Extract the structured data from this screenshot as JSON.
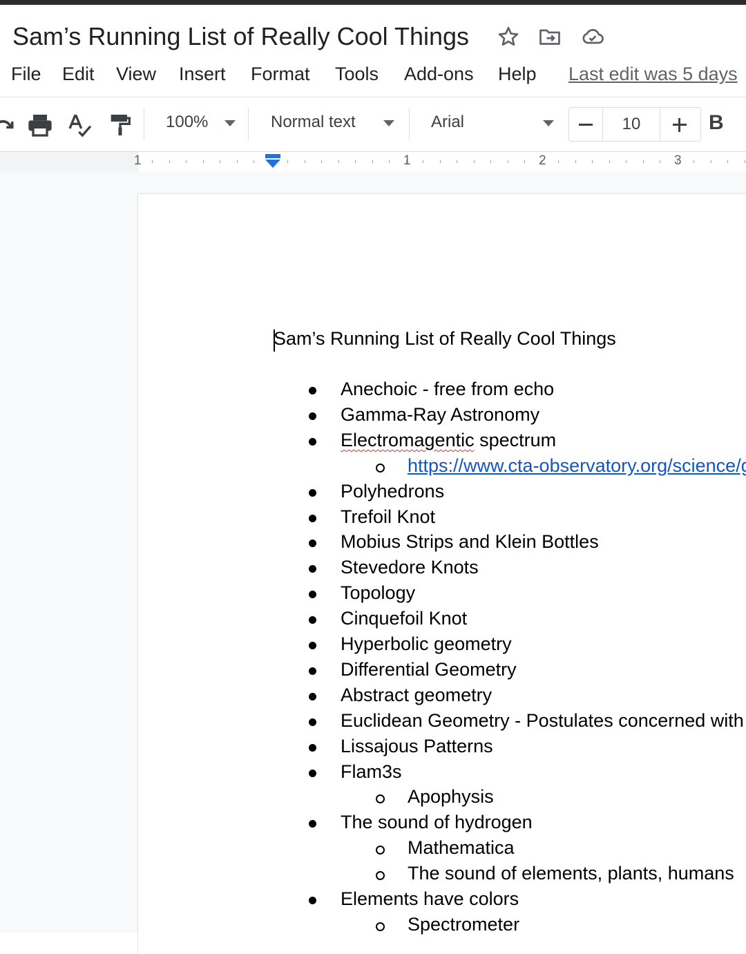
{
  "title": "Sam’s Running List of Really Cool Things",
  "title_icons": [
    "star-icon",
    "move-to-folder-icon",
    "cloud-saved-icon"
  ],
  "menu": {
    "items": [
      "File",
      "Edit",
      "View",
      "Insert",
      "Format",
      "Tools",
      "Add-ons",
      "Help"
    ],
    "last_edit": "Last edit was 5 days"
  },
  "toolbar": {
    "zoom": "100%",
    "style": "Normal text",
    "font": "Arial",
    "font_size": "10",
    "bold_label": "B"
  },
  "ruler": {
    "numbers": [
      "1",
      "1",
      "2",
      "3"
    ]
  },
  "document": {
    "heading": "Sam’s Running List of Really Cool Things",
    "items": [
      {
        "level": 1,
        "text": "Anechoic - free from echo"
      },
      {
        "level": 1,
        "text": "Gamma-Ray Astronomy"
      },
      {
        "level": 1,
        "text": "Electromagentic spectrum",
        "misspelled": true
      },
      {
        "level": 2,
        "text": "https://www.cta-observatory.org/science/g",
        "link": true
      },
      {
        "level": 1,
        "text": "Polyhedrons"
      },
      {
        "level": 1,
        "text": "Trefoil Knot"
      },
      {
        "level": 1,
        "text": "Mobius Strips and Klein Bottles"
      },
      {
        "level": 1,
        "text": "Stevedore Knots"
      },
      {
        "level": 1,
        "text": "Topology"
      },
      {
        "level": 1,
        "text": "Cinquefoil Knot"
      },
      {
        "level": 1,
        "text": "Hyperbolic geometry"
      },
      {
        "level": 1,
        "text": "Differential Geometry"
      },
      {
        "level": 1,
        "text": "Abstract geometry"
      },
      {
        "level": 1,
        "text": "Euclidean Geometry - Postulates concerned with I"
      },
      {
        "level": 1,
        "text": "Lissajous Patterns"
      },
      {
        "level": 1,
        "text": "Flam3s"
      },
      {
        "level": 2,
        "text": "Apophysis"
      },
      {
        "level": 1,
        "text": "The sound of hydrogen"
      },
      {
        "level": 2,
        "text": "Mathematica"
      },
      {
        "level": 2,
        "text": "The sound of elements, plants, humans"
      },
      {
        "level": 1,
        "text": "Elements have colors"
      },
      {
        "level": 2,
        "text": "Spectrometer"
      }
    ]
  },
  "colors": {
    "link": "#1155cc",
    "ruler_marker": "#1a73e8",
    "spell_error": "#d93025"
  }
}
